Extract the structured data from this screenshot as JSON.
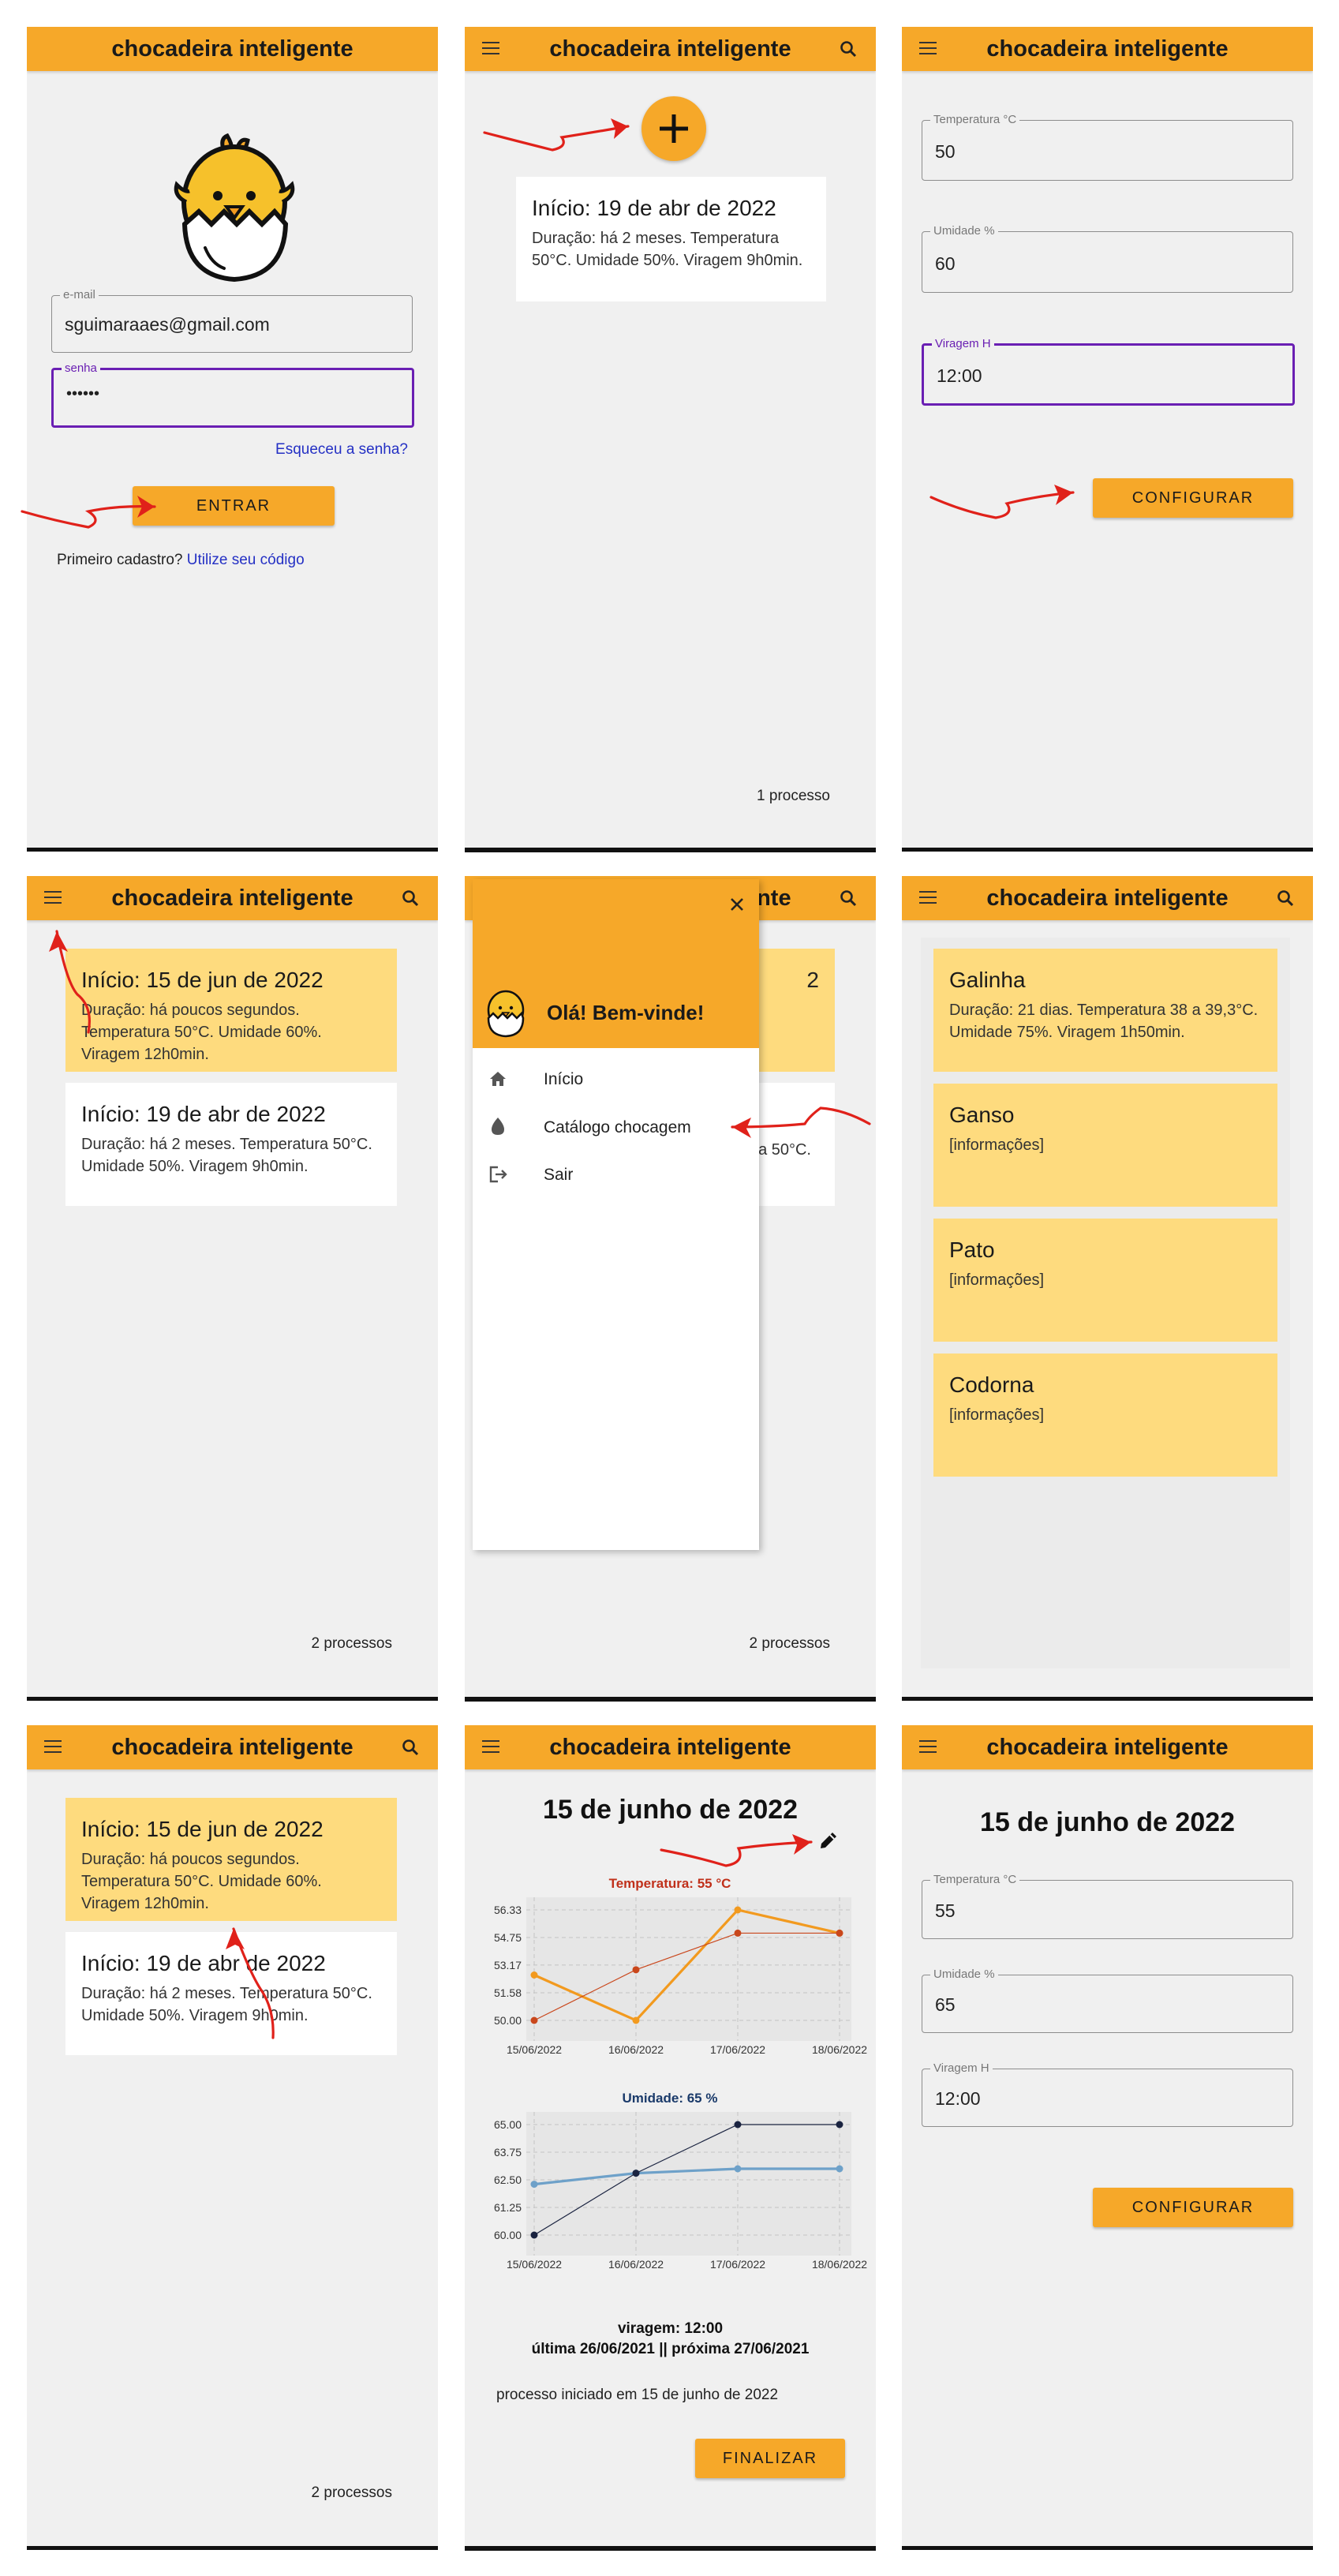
{
  "app_title": "chocadeira inteligente",
  "colors": {
    "accent": "#f6a829",
    "card_highlight": "#fedb7e",
    "focus": "#6a1fb3",
    "annotation_arrow": "#e0211a"
  },
  "login": {
    "email_label": "e-mail",
    "email_value": "sguimaraaes@gmail.com",
    "password_label": "senha",
    "password_value": "••••••",
    "forgot": "Esqueceu a senha?",
    "enter": "ENTRAR",
    "first_signup": "Primeiro cadastro?",
    "use_code": "Utilize seu código"
  },
  "list_one": {
    "card": {
      "title": "Início: 19 de abr de 2022",
      "desc": "Duração: há 2 meses. Temperatura 50°C. Umidade 50%. Viragem 9h0min."
    },
    "count": "1 processo"
  },
  "config_new": {
    "temp_label": "Temperatura °C",
    "temp_value": "50",
    "hum_label": "Umidade %",
    "hum_value": "60",
    "turn_label": "Viragem H",
    "turn_value": "12:00",
    "button": "CONFIGURAR"
  },
  "list_two": {
    "cards": [
      {
        "title": "Início: 15 de jun de 2022",
        "desc": "Duração: há poucos segundos. Temperatura 50°C. Umidade 60%. Viragem 12h0min."
      },
      {
        "title": "Início: 19 de abr de 2022",
        "desc": "Duração: há 2 meses. Temperatura 50°C. Umidade 50%. Viragem 9h0min."
      }
    ],
    "count": "2 processos"
  },
  "drawer": {
    "greeting": "Olá! Bem-vinde!",
    "items": [
      {
        "label": "Início",
        "icon": "home-icon"
      },
      {
        "label": "Catálogo chocagem",
        "icon": "egg-icon"
      },
      {
        "label": "Sair",
        "icon": "logout-icon"
      }
    ],
    "bg_card_peek": "a 50°C.",
    "bg_title_peek": "2"
  },
  "catalog": {
    "items": [
      {
        "title": "Galinha",
        "desc": "Duração: 21 dias. Temperatura 38 a 39,3°C. Umidade 75%. Viragem 1h50min."
      },
      {
        "title": "Ganso",
        "desc": "[informações]"
      },
      {
        "title": "Pato",
        "desc": "[informações]"
      },
      {
        "title": "Codorna",
        "desc": "[informações]"
      }
    ]
  },
  "detail": {
    "title": "15 de junho de 2022",
    "turning": "viragem: 12:00",
    "last_next": "última 26/06/2021 || próxima 27/06/2021",
    "started": "processo iniciado em 15 de junho de 2022",
    "finish": "FINALIZAR"
  },
  "chart_data": [
    {
      "type": "line",
      "title": "Temperatura: 55 °C",
      "x": [
        "15/06/2022",
        "16/06/2022",
        "17/06/2022",
        "18/06/2022"
      ],
      "yticks": [
        "50.00",
        "51.58",
        "53.17",
        "54.75",
        "56.33"
      ],
      "ylim": [
        50,
        56.33
      ],
      "series": [
        {
          "color": "#f29a1f",
          "values": [
            52.6,
            50.0,
            56.33,
            55.0
          ]
        },
        {
          "color": "#c9471c",
          "values": [
            50.0,
            52.9,
            55.0,
            55.0
          ]
        }
      ],
      "grid": true
    },
    {
      "type": "line",
      "title": "Umidade: 65 %",
      "x": [
        "15/06/2022",
        "16/06/2022",
        "17/06/2022",
        "18/06/2022"
      ],
      "yticks": [
        "60.00",
        "61.25",
        "62.50",
        "63.75",
        "65.00"
      ],
      "ylim": [
        60,
        65
      ],
      "series": [
        {
          "color": "#6ea1c9",
          "values": [
            62.3,
            62.8,
            63.0,
            63.0
          ]
        },
        {
          "color": "#1a2340",
          "values": [
            60.0,
            62.8,
            65.0,
            65.0
          ]
        }
      ],
      "grid": true
    }
  ],
  "config_edit": {
    "title": "15 de junho de 2022",
    "temp_label": "Temperatura °C",
    "temp_value": "55",
    "hum_label": "Umidade %",
    "hum_value": "65",
    "turn_label": "Viragem H",
    "turn_value": "12:00",
    "button": "CONFIGURAR"
  }
}
